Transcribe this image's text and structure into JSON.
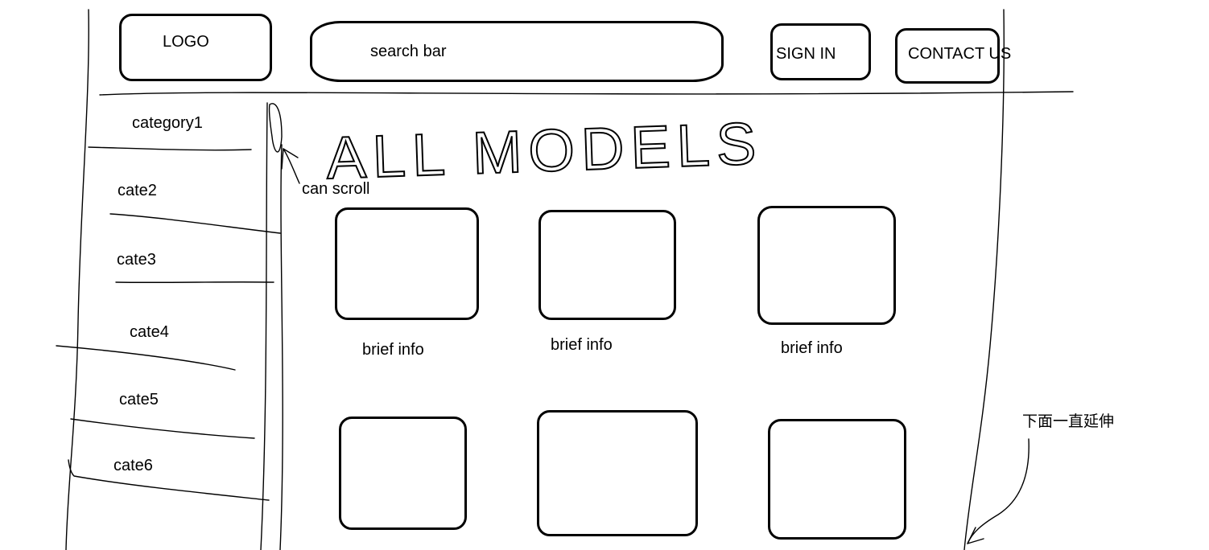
{
  "header": {
    "logo_label": "LOGO",
    "search_placeholder": "search bar",
    "signin_label": "SIGN IN",
    "contact_label": "CONTACT US"
  },
  "sidebar": {
    "items": [
      {
        "label": "category1"
      },
      {
        "label": "cate2"
      },
      {
        "label": "cate3"
      },
      {
        "label": "cate4"
      },
      {
        "label": "cate5"
      },
      {
        "label": "cate6"
      }
    ],
    "scroll_note": "can scroll"
  },
  "main": {
    "title": "ALL MODELS",
    "cards": [
      {
        "caption": "brief info"
      },
      {
        "caption": "brief info"
      },
      {
        "caption": "brief info"
      },
      {
        "caption": ""
      },
      {
        "caption": ""
      },
      {
        "caption": ""
      }
    ],
    "extend_note": "下面一直延伸"
  },
  "colors": {
    "ink": "#000000",
    "background": "#ffffff"
  }
}
